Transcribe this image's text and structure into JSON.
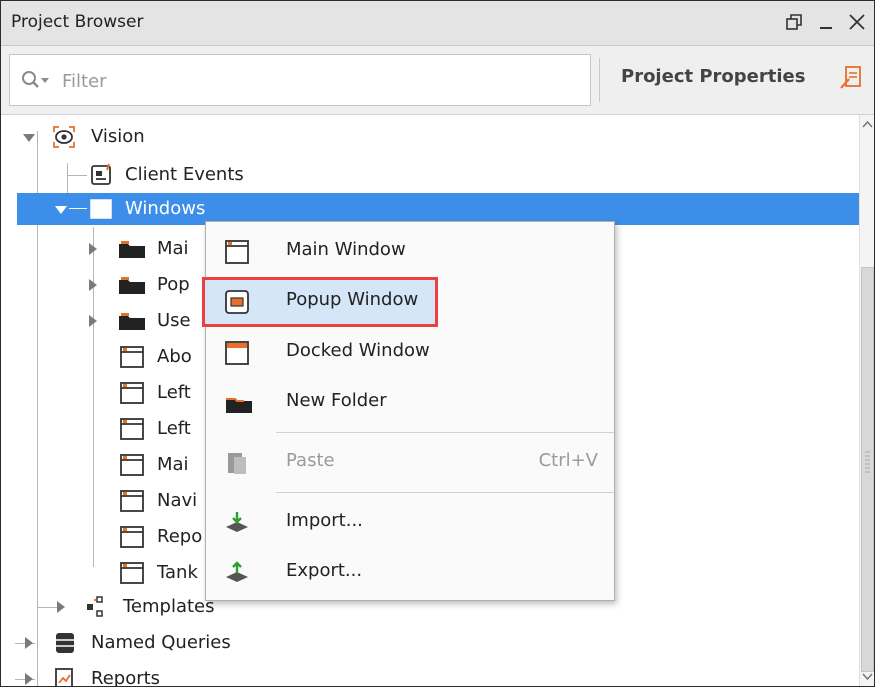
{
  "window": {
    "title": "Project Browser"
  },
  "toolbar": {
    "filter_placeholder": "Filter",
    "project_properties_label": "Project Properties"
  },
  "tree": {
    "vision": "Vision",
    "client_events": "Client Events",
    "windows": "Windows",
    "children": [
      "Mai",
      "Pop",
      "Use",
      "Abo",
      "Left",
      "Left",
      "Mai",
      "Navi",
      "Repo",
      "Tank"
    ],
    "templates": "Templates",
    "named_queries": "Named Queries",
    "reports": "Reports"
  },
  "context_menu": {
    "main_window": "Main Window",
    "popup_window": "Popup Window",
    "docked_window": "Docked Window",
    "new_folder": "New Folder",
    "paste": "Paste",
    "paste_shortcut": "Ctrl+V",
    "import": "Import...",
    "export": "Export..."
  },
  "colors": {
    "selection": "#3d8ee8",
    "highlight_border": "#e8413f",
    "highlight_fill": "#d4e6f8",
    "accent_orange": "#e8702a"
  }
}
